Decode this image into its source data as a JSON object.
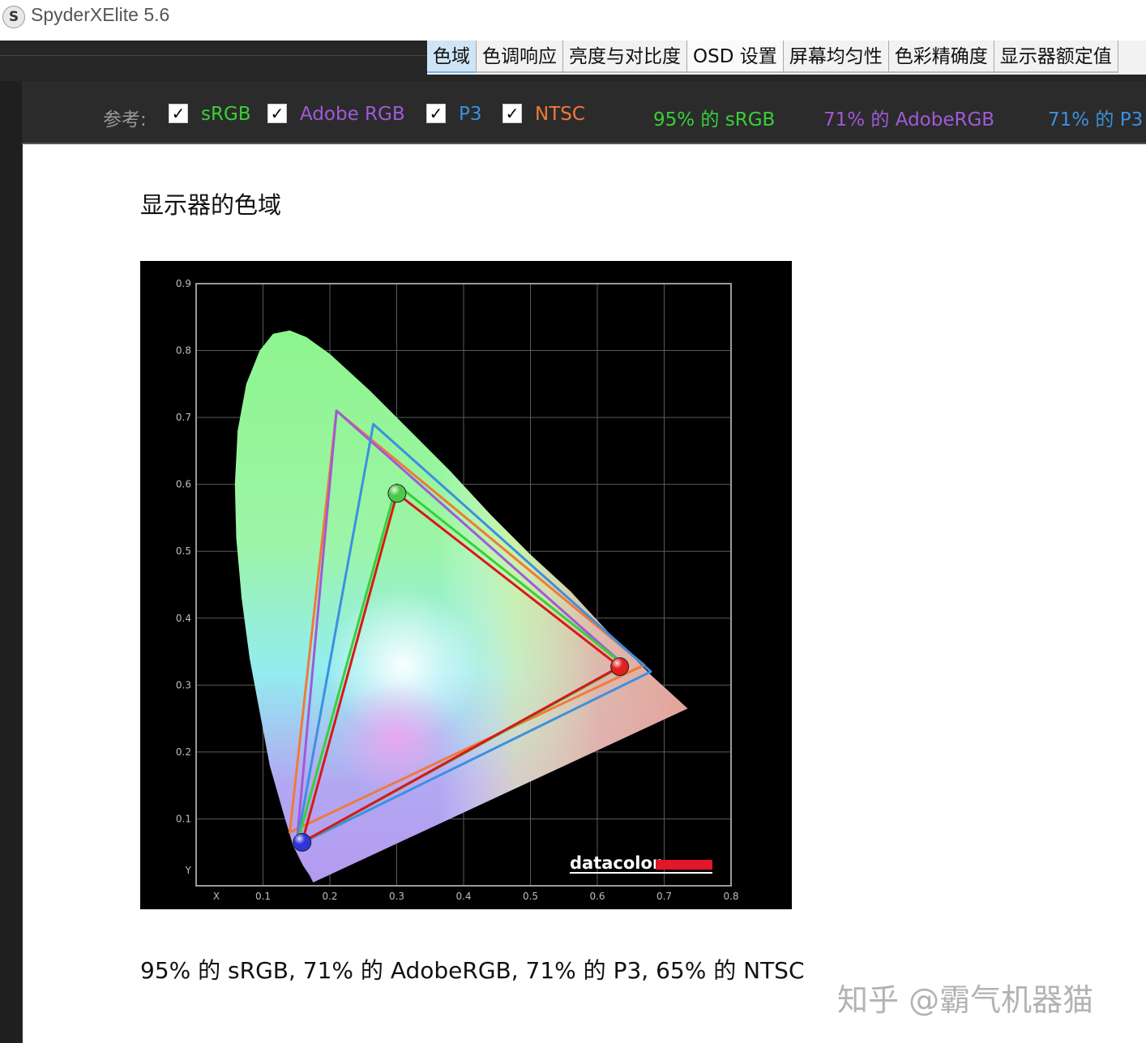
{
  "app": {
    "title": "SpyderXElite 5.6",
    "icon_glyph": "S"
  },
  "tabs": [
    {
      "label": "色域",
      "active": true
    },
    {
      "label": "色调响应",
      "active": false
    },
    {
      "label": "亮度与对比度",
      "active": false
    },
    {
      "label": "OSD 设置",
      "active": false
    },
    {
      "label": "屏幕均匀性",
      "active": false
    },
    {
      "label": "色彩精确度",
      "active": false
    },
    {
      "label": "显示器额定值",
      "active": false
    }
  ],
  "reference": {
    "label": "参考:",
    "items": [
      {
        "name": "sRGB",
        "checked": true,
        "color": "#38d038"
      },
      {
        "name": "Adobe RGB",
        "checked": true,
        "color": "#a05ad8"
      },
      {
        "name": "P3",
        "checked": true,
        "color": "#3c90e0"
      },
      {
        "name": "NTSC",
        "checked": true,
        "color": "#f07a3a"
      }
    ],
    "stats": [
      {
        "text": "95% 的 sRGB",
        "color": "#38d038"
      },
      {
        "text": "71% 的 AdobeRGB",
        "color": "#a05ad8"
      },
      {
        "text": "71% 的 P3",
        "color": "#3c90e0"
      }
    ]
  },
  "content": {
    "heading": "显示器的色域",
    "summary": "95% 的 sRGB, 71% 的 AdobeRGB, 71% 的 P3, 65% 的 NTSC",
    "watermark": "知乎 @霸气机器猫"
  },
  "chart_data": {
    "type": "scatter",
    "title": "",
    "xlabel": "X",
    "ylabel": "Y",
    "xlim": [
      0.0,
      0.8
    ],
    "ylim": [
      0.0,
      0.9
    ],
    "xticks": [
      "0.1",
      "0.2",
      "0.3",
      "0.4",
      "0.5",
      "0.6",
      "0.7",
      "0.8"
    ],
    "yticks": [
      "0.1",
      "0.2",
      "0.3",
      "0.4",
      "0.5",
      "0.6",
      "0.7",
      "0.8",
      "0.9"
    ],
    "grid": true,
    "brand": "datacolor",
    "spectral_locus": [
      [
        0.175,
        0.005
      ],
      [
        0.17,
        0.015
      ],
      [
        0.16,
        0.03
      ],
      [
        0.145,
        0.06
      ],
      [
        0.13,
        0.11
      ],
      [
        0.11,
        0.18
      ],
      [
        0.095,
        0.26
      ],
      [
        0.08,
        0.34
      ],
      [
        0.068,
        0.43
      ],
      [
        0.06,
        0.52
      ],
      [
        0.058,
        0.6
      ],
      [
        0.062,
        0.68
      ],
      [
        0.075,
        0.75
      ],
      [
        0.095,
        0.8
      ],
      [
        0.115,
        0.825
      ],
      [
        0.14,
        0.83
      ],
      [
        0.165,
        0.82
      ],
      [
        0.2,
        0.795
      ],
      [
        0.26,
        0.74
      ],
      [
        0.32,
        0.68
      ],
      [
        0.38,
        0.62
      ],
      [
        0.44,
        0.555
      ],
      [
        0.5,
        0.495
      ],
      [
        0.56,
        0.44
      ],
      [
        0.62,
        0.375
      ],
      [
        0.68,
        0.315
      ],
      [
        0.735,
        0.265
      ]
    ],
    "series": [
      {
        "name": "NTSC",
        "color": "#f07a3a",
        "points": [
          [
            0.67,
            0.33
          ],
          [
            0.21,
            0.71
          ],
          [
            0.14,
            0.08
          ]
        ]
      },
      {
        "name": "Adobe RGB",
        "color": "#a05ad8",
        "points": [
          [
            0.64,
            0.33
          ],
          [
            0.21,
            0.71
          ],
          [
            0.15,
            0.06
          ]
        ]
      },
      {
        "name": "P3",
        "color": "#3c90e0",
        "points": [
          [
            0.68,
            0.32
          ],
          [
            0.265,
            0.69
          ],
          [
            0.15,
            0.06
          ]
        ]
      },
      {
        "name": "sRGB",
        "color": "#38d038",
        "points": [
          [
            0.64,
            0.33
          ],
          [
            0.3,
            0.6
          ],
          [
            0.15,
            0.06
          ]
        ]
      },
      {
        "name": "Display",
        "color": "#d81818",
        "points": [
          [
            0.6335,
            0.3275
          ],
          [
            0.3005,
            0.5865
          ],
          [
            0.1585,
            0.065
          ]
        ]
      }
    ],
    "primaries": [
      {
        "name": "red",
        "x": 0.6335,
        "y": 0.3275,
        "color": "#e02020"
      },
      {
        "name": "green",
        "x": 0.3005,
        "y": 0.5865,
        "color": "#4cc84c"
      },
      {
        "name": "blue",
        "x": 0.1585,
        "y": 0.065,
        "color": "#2f35d8"
      }
    ]
  }
}
